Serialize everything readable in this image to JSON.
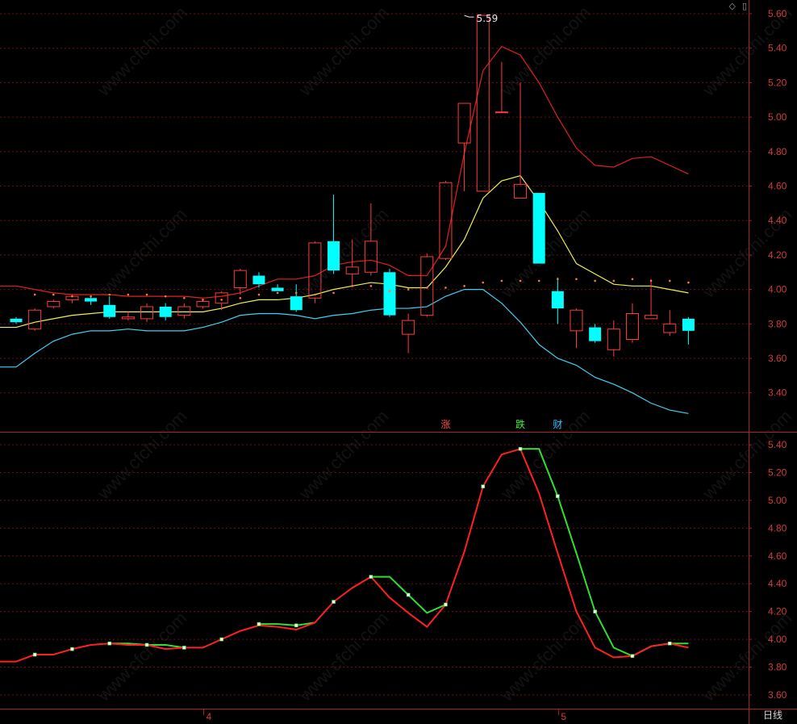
{
  "window": {
    "period_label": "日线",
    "watermark_text": "www.cfchi.com",
    "corner_icons": [
      "diamond-icon",
      "panel-icon"
    ]
  },
  "colors": {
    "background": "#000000",
    "up": "#ff3b3b",
    "down": "#00ffff",
    "grid": "#6e1010",
    "frame": "#b01e1e",
    "axis_text": "#d23c3c",
    "upper_band": "#e02020",
    "middle_band": "#f0f050",
    "lower_band": "#40d0f0",
    "dot_line": "#ff7a3c",
    "lower_line_red": "#ff2020",
    "lower_line_green": "#30e030"
  },
  "chart_data": [
    {
      "type": "candlestick",
      "panel": "main",
      "ylim": [
        3.25,
        5.62
      ],
      "y_ticks": [
        "5.60",
        "5.40",
        "5.20",
        "5.00",
        "4.80",
        "4.60",
        "4.40",
        "4.20",
        "4.00",
        "3.80",
        "3.60",
        "3.40"
      ],
      "x_tick_labels": [
        {
          "index": 10,
          "label": "4"
        },
        {
          "index": 29,
          "label": "5"
        }
      ],
      "max_annotation": {
        "index": 24,
        "value": 5.59,
        "label": "5.59"
      },
      "event_markers": [
        {
          "index": 23,
          "label": "涨",
          "color": "#ff5050"
        },
        {
          "index": 27,
          "label": "跌",
          "color": "#40f040"
        },
        {
          "index": 29,
          "label": "财",
          "color": "#40c0ff"
        }
      ],
      "candles": [
        {
          "o": 3.83,
          "h": 3.84,
          "l": 3.8,
          "c": 3.81
        },
        {
          "o": 3.77,
          "h": 3.89,
          "l": 3.76,
          "c": 3.88
        },
        {
          "o": 3.9,
          "h": 3.94,
          "l": 3.89,
          "c": 3.93
        },
        {
          "o": 3.94,
          "h": 3.97,
          "l": 3.92,
          "c": 3.96
        },
        {
          "o": 3.95,
          "h": 3.96,
          "l": 3.91,
          "c": 3.93
        },
        {
          "o": 3.91,
          "h": 3.96,
          "l": 3.83,
          "c": 3.84
        },
        {
          "o": 3.83,
          "h": 3.87,
          "l": 3.82,
          "c": 3.84
        },
        {
          "o": 3.83,
          "h": 3.92,
          "l": 3.81,
          "c": 3.9
        },
        {
          "o": 3.9,
          "h": 3.92,
          "l": 3.82,
          "c": 3.84
        },
        {
          "o": 3.85,
          "h": 3.92,
          "l": 3.83,
          "c": 3.9
        },
        {
          "o": 3.9,
          "h": 3.94,
          "l": 3.89,
          "c": 3.93
        },
        {
          "o": 3.92,
          "h": 3.99,
          "l": 3.88,
          "c": 3.98
        },
        {
          "o": 4.01,
          "h": 4.12,
          "l": 3.97,
          "c": 4.11
        },
        {
          "o": 4.08,
          "h": 4.1,
          "l": 4.01,
          "c": 4.03
        },
        {
          "o": 4.01,
          "h": 4.03,
          "l": 3.99,
          "c": 3.99
        },
        {
          "o": 3.96,
          "h": 4.03,
          "l": 3.87,
          "c": 3.88
        },
        {
          "o": 3.95,
          "h": 4.28,
          "l": 3.92,
          "c": 4.27
        },
        {
          "o": 4.28,
          "h": 4.55,
          "l": 4.09,
          "c": 4.11
        },
        {
          "o": 4.09,
          "h": 4.29,
          "l": 4.02,
          "c": 4.13
        },
        {
          "o": 4.1,
          "h": 4.5,
          "l": 4.08,
          "c": 4.28
        },
        {
          "o": 4.1,
          "h": 4.12,
          "l": 3.84,
          "c": 3.85
        },
        {
          "o": 3.74,
          "h": 3.86,
          "l": 3.63,
          "c": 3.82
        },
        {
          "o": 3.85,
          "h": 4.21,
          "l": 3.84,
          "c": 4.19
        },
        {
          "o": 4.18,
          "h": 4.63,
          "l": 4.17,
          "c": 4.62
        },
        {
          "o": 4.85,
          "h": 5.08,
          "l": 4.57,
          "c": 5.08
        },
        {
          "o": 4.57,
          "h": 5.59,
          "l": 4.57,
          "c": 5.59
        },
        {
          "o": 5.03,
          "h": 5.32,
          "l": 5.03,
          "c": 5.03
        },
        {
          "o": 4.53,
          "h": 5.2,
          "l": 4.53,
          "c": 4.61
        },
        {
          "o": 4.56,
          "h": 4.56,
          "l": 4.15,
          "c": 4.15
        },
        {
          "o": 3.99,
          "h": 4.07,
          "l": 3.8,
          "c": 3.89
        },
        {
          "o": 3.76,
          "h": 3.89,
          "l": 3.66,
          "c": 3.88
        },
        {
          "o": 3.78,
          "h": 3.8,
          "l": 3.69,
          "c": 3.7
        },
        {
          "o": 3.65,
          "h": 3.82,
          "l": 3.61,
          "c": 3.77
        },
        {
          "o": 3.71,
          "h": 3.92,
          "l": 3.69,
          "c": 3.86
        },
        {
          "o": 3.83,
          "h": 4.06,
          "l": 3.83,
          "c": 3.85
        },
        {
          "o": 3.75,
          "h": 3.88,
          "l": 3.73,
          "c": 3.8
        },
        {
          "o": 3.83,
          "h": 3.84,
          "l": 3.68,
          "c": 3.76
        }
      ],
      "series": [
        {
          "role": "upper-band",
          "color": "#e02020",
          "values": [
            4.02,
            4.0,
            3.98,
            3.97,
            3.97,
            3.97,
            3.96,
            3.96,
            3.96,
            3.96,
            3.95,
            3.96,
            3.98,
            4.02,
            4.06,
            4.06,
            4.08,
            4.14,
            4.16,
            4.17,
            4.14,
            4.08,
            4.08,
            4.25,
            4.79,
            5.27,
            5.41,
            5.36,
            5.2,
            5.0,
            4.82,
            4.72,
            4.71,
            4.76,
            4.77,
            4.72,
            4.67
          ]
        },
        {
          "role": "middle-band",
          "color": "#f0f050",
          "values": [
            3.78,
            3.81,
            3.83,
            3.85,
            3.86,
            3.87,
            3.87,
            3.87,
            3.87,
            3.87,
            3.87,
            3.89,
            3.92,
            3.94,
            3.94,
            3.95,
            3.97,
            4.0,
            4.02,
            4.04,
            4.03,
            4.01,
            4.01,
            4.13,
            4.29,
            4.53,
            4.63,
            4.66,
            4.51,
            4.34,
            4.15,
            4.09,
            4.03,
            4.02,
            4.02,
            4.0,
            3.98
          ]
        },
        {
          "role": "lower-band",
          "color": "#40d0f0",
          "values": [
            3.55,
            3.63,
            3.7,
            3.74,
            3.76,
            3.76,
            3.77,
            3.76,
            3.76,
            3.76,
            3.78,
            3.81,
            3.85,
            3.86,
            3.86,
            3.85,
            3.83,
            3.85,
            3.86,
            3.88,
            3.89,
            3.89,
            3.9,
            3.96,
            4.0,
            4.0,
            3.92,
            3.81,
            3.68,
            3.6,
            3.56,
            3.49,
            3.45,
            3.4,
            3.34,
            3.3,
            3.28
          ]
        },
        {
          "role": "dot-line",
          "color": "#ff7a3c",
          "values": [
            null,
            3.97,
            3.97,
            3.96,
            3.96,
            3.97,
            3.97,
            3.97,
            3.96,
            3.95,
            3.94,
            3.94,
            3.95,
            3.97,
            3.98,
            3.98,
            3.97,
            3.98,
            4.02,
            4.02,
            3.99,
            4.0,
            4.01,
            4.01,
            4.02,
            4.04,
            4.05,
            4.05,
            4.05,
            4.06,
            4.06,
            4.05,
            4.05,
            4.06,
            4.05,
            4.05,
            4.04
          ]
        }
      ]
    },
    {
      "type": "line",
      "panel": "lower",
      "ylim": [
        3.55,
        5.48
      ],
      "y_ticks": [
        "5.40",
        "5.20",
        "5.00",
        "4.80",
        "4.60",
        "4.40",
        "4.20",
        "4.00",
        "3.80",
        "3.60"
      ],
      "series": [
        {
          "role": "red-line",
          "color": "#ff2020",
          "values": [
            3.84,
            3.89,
            3.89,
            3.93,
            3.96,
            3.97,
            3.96,
            3.96,
            3.93,
            3.94,
            3.94,
            4.0,
            4.06,
            4.1,
            4.09,
            4.07,
            4.12,
            4.27,
            4.37,
            4.45,
            4.3,
            4.19,
            4.09,
            4.25,
            4.63,
            5.1,
            5.33,
            5.37,
            5.05,
            4.62,
            4.2,
            3.94,
            3.87,
            3.88,
            3.95,
            3.97,
            3.94
          ]
        },
        {
          "role": "green-line",
          "color": "#30e030",
          "values": [
            null,
            null,
            null,
            null,
            null,
            3.97,
            3.97,
            3.96,
            3.96,
            3.94,
            null,
            null,
            null,
            4.11,
            4.11,
            4.1,
            4.12,
            null,
            null,
            4.45,
            4.45,
            4.32,
            4.19,
            4.25,
            null,
            null,
            null,
            5.37,
            5.37,
            5.03,
            4.62,
            4.2,
            3.94,
            3.88,
            3.95,
            3.97,
            3.97
          ]
        }
      ],
      "marker_indices": [
        1,
        3,
        5,
        7,
        9,
        11,
        13,
        15,
        17,
        19,
        21,
        23,
        25,
        27,
        29,
        31,
        33,
        35
      ]
    }
  ]
}
